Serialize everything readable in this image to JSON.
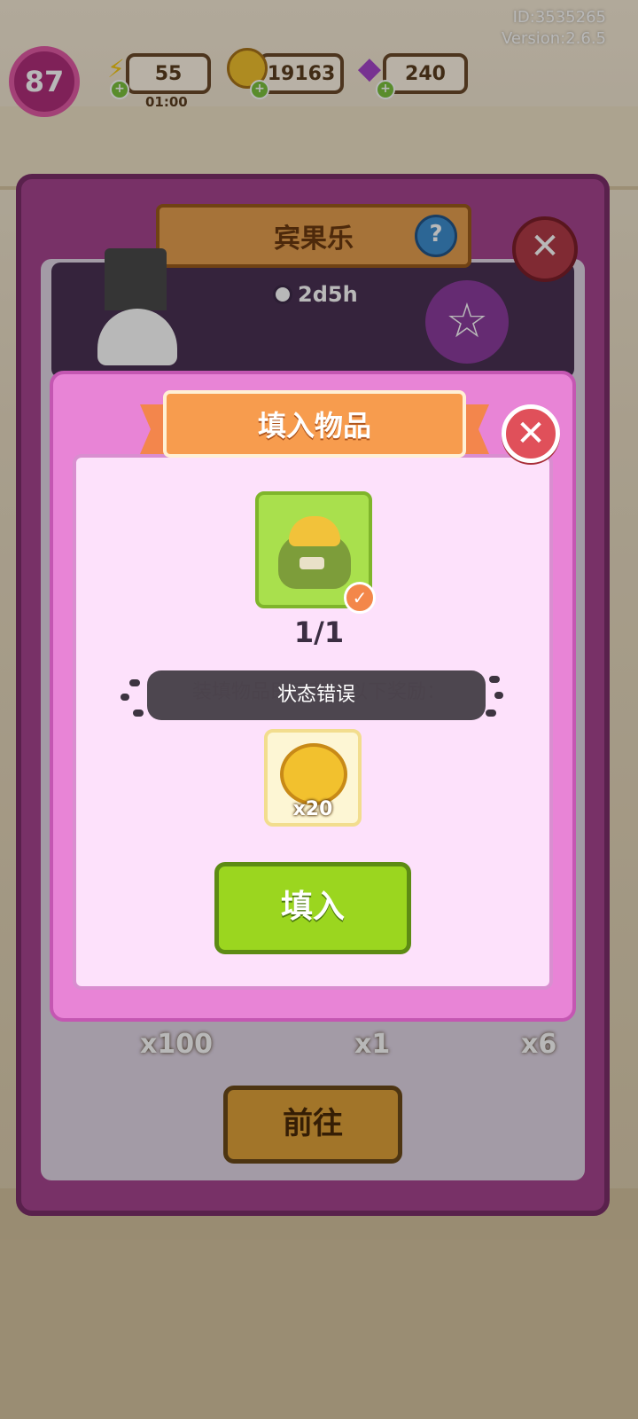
{
  "app": {
    "id_label": "ID:3535265",
    "version_label": "Version:2.6.5"
  },
  "hud": {
    "level": "87",
    "energy": {
      "value": "55",
      "timer": "01:00",
      "icon": "lightning-icon"
    },
    "coins": {
      "value": "19163",
      "icon": "coin-icon"
    },
    "gems": {
      "value": "240",
      "icon": "gem-icon"
    }
  },
  "bingo_panel": {
    "title": "宾果乐",
    "countdown": "2d5h",
    "bottom_rewards": [
      "x100",
      "x1",
      "x6"
    ],
    "go_label": "前往"
  },
  "fill_modal": {
    "title": "填入物品",
    "item_icon": "coin-sack-icon",
    "item_progress": "1/1",
    "reward_text": "装填物品即可获得以下奖励：",
    "reward_icon": "coin-icon",
    "reward_quantity": "x20",
    "fill_button_label": "填入"
  },
  "toast": {
    "message": "状态错误"
  },
  "colors": {
    "modal_border": "#e884d6",
    "modal_inner": "#fde1fb",
    "banner_orange": "#f79c4e",
    "fill_button": "#9bd61f",
    "close_button": "#e0505a",
    "back_panel": "#a7458f"
  }
}
